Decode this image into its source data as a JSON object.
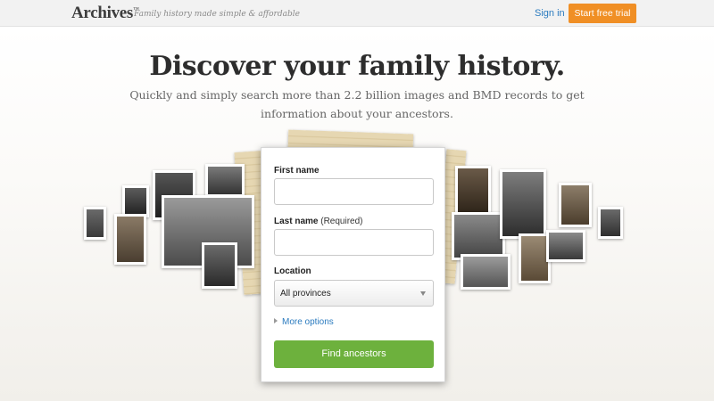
{
  "header": {
    "logo": "Archives",
    "logo_mark": "™",
    "tagline": "Family history made simple & affordable",
    "signin_label": "Sign in",
    "trial_label": "Start free trial"
  },
  "hero": {
    "title": "Discover your family history.",
    "subtitle": "Quickly and simply search more than 2.2 billion images and BMD records to get information about your ancestors."
  },
  "form": {
    "first_name_label": "First name",
    "first_name_value": "",
    "last_name_label": "Last name",
    "last_name_required": "(Required)",
    "last_name_value": "",
    "location_label": "Location",
    "location_value": "All provinces",
    "more_options_label": "More options",
    "submit_label": "Find ancestors"
  },
  "colors": {
    "accent_orange": "#f08f25",
    "accent_green": "#6db13d",
    "link_blue": "#2b7bbf"
  }
}
